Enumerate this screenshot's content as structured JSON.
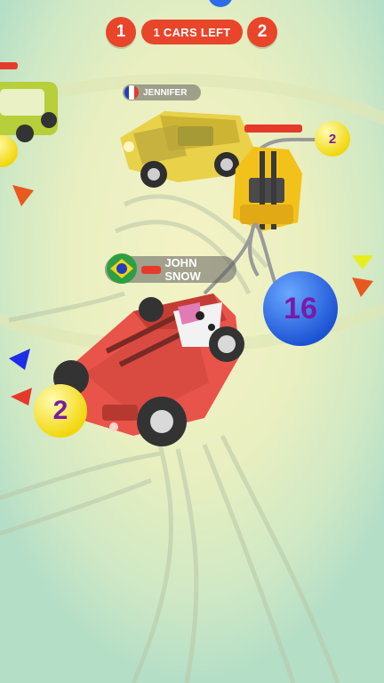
{
  "hud": {
    "left_count": "1",
    "status": "1 CARS LEFT",
    "right_count": "2"
  },
  "players": [
    {
      "name": "JENNIFER",
      "flag": "France"
    },
    {
      "name": "JOHN SNOW",
      "flag": "Brazil"
    }
  ],
  "balls": [
    {
      "owner": "player",
      "value": "16",
      "color": "#2b6de8"
    },
    {
      "owner": "yellow-car",
      "value": "2",
      "color": "#ffe61a"
    },
    {
      "owner": "jennifer",
      "value": "2",
      "color": "#ffe61a"
    }
  ],
  "colors": {
    "hud": "#e8452b",
    "ground": "#bfe3c4",
    "arena_center": "#f2f2c2",
    "player_car": "#e8534a",
    "ball_text": "#7a1aa6"
  },
  "offscreen_pointers": [
    "orange-arrow",
    "yellow-arrow",
    "blue-arrow",
    "red-arrow"
  ]
}
